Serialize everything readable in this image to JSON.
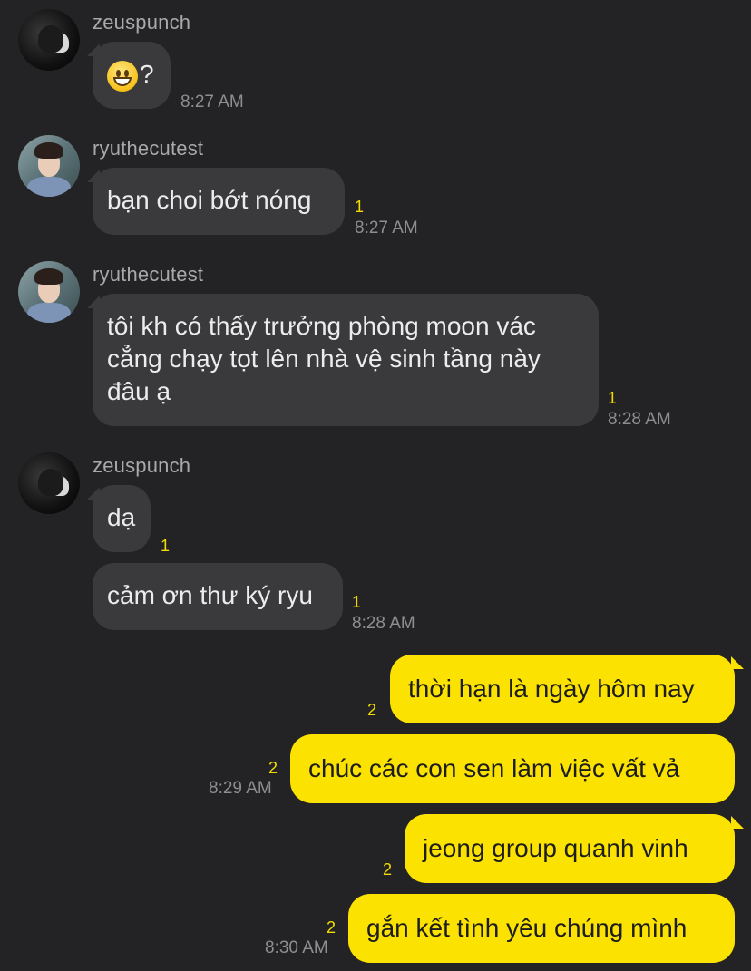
{
  "chat": {
    "messages": [
      {
        "sender": "zeuspunch",
        "emoji": "grinning-face-emoji",
        "text": "?",
        "time": "8:27 AM"
      },
      {
        "sender": "ryuthecutest",
        "text": "bạn choi bớt nóng",
        "unread": "1",
        "time": "8:27 AM"
      },
      {
        "sender": "ryuthecutest",
        "lines": [
          "tôi kh có thấy trưởng phòng moon vác",
          "cẳng chạy tọt lên nhà vệ sinh tầng này",
          "đâu ạ"
        ],
        "unread": "1",
        "time": "8:28 AM"
      },
      {
        "sender": "zeuspunch",
        "text": "dạ",
        "unread": "1"
      },
      {
        "text": "cảm ơn thư ký ryu",
        "unread": "1",
        "time": "8:28 AM"
      },
      {
        "text": "thời hạn là ngày hôm nay",
        "unread": "2",
        "outgoing": true
      },
      {
        "text": "chúc các con sen làm việc vất vả",
        "unread": "2",
        "time": "8:29 AM",
        "outgoing": true
      },
      {
        "text": "jeong group quanh vinh",
        "unread": "2",
        "outgoing": true
      },
      {
        "text": "gắn kết tình yêu chúng mình",
        "unread": "2",
        "time": "8:30 AM",
        "outgoing": true
      }
    ]
  },
  "colors": {
    "background": "#232325",
    "incoming_bubble": "#3a3a3d",
    "outgoing_bubble": "#fbe200",
    "unread_count": "#f2dc00"
  }
}
